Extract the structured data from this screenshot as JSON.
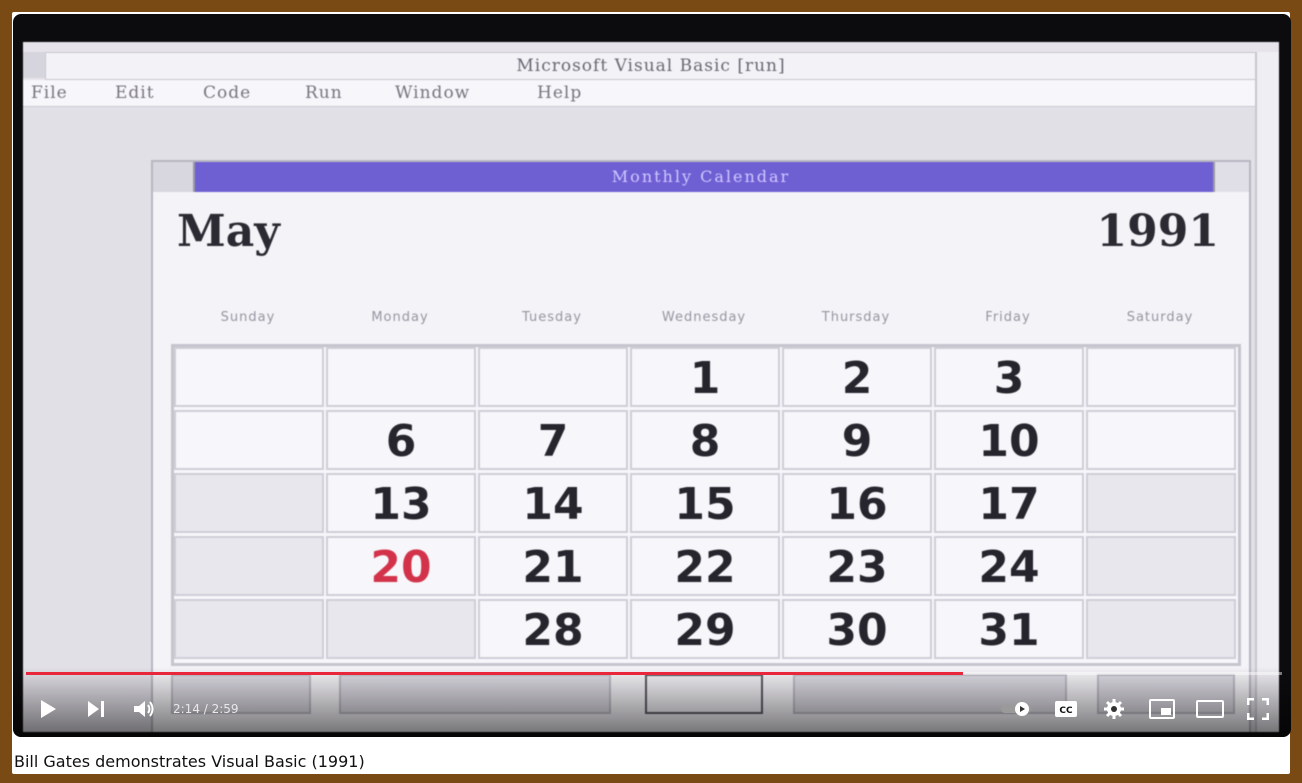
{
  "video": {
    "title": "Bill Gates demonstrates Visual Basic (1991)",
    "time_display": "2:14 / 2:59",
    "progress_fraction": 0.746
  },
  "vb_app": {
    "window_title": "Microsoft Visual Basic [run]",
    "menu": [
      "File",
      "Edit",
      "Code",
      "Run",
      "Window",
      "Help"
    ],
    "form_title": "Monthly Calendar"
  },
  "calendar": {
    "month": "May",
    "year": "1991",
    "day_names": [
      "Sunday",
      "Monday",
      "Tuesday",
      "Wednesday",
      "Thursday",
      "Friday",
      "Saturday"
    ],
    "weeks": [
      [
        "",
        "",
        "",
        "1",
        "2",
        "3",
        ""
      ],
      [
        "",
        "6",
        "7",
        "8",
        "9",
        "10",
        ""
      ],
      [
        "",
        "13",
        "14",
        "15",
        "16",
        "17",
        ""
      ],
      [
        "",
        "20",
        "21",
        "22",
        "23",
        "24",
        ""
      ],
      [
        "",
        "",
        "28",
        "29",
        "30",
        "31",
        ""
      ]
    ],
    "highlight_day": "20",
    "highlight_color": "#d2334a"
  },
  "colors": {
    "page_border": "#7a4a14",
    "progress": "#e8283a",
    "titlebar": "#6e5fd3"
  },
  "icons": [
    "play-icon",
    "next-icon",
    "volume-icon",
    "autoplay-toggle-icon",
    "cc-icon",
    "gear-icon",
    "miniplayer-icon",
    "theater-icon",
    "fullscreen-icon"
  ]
}
